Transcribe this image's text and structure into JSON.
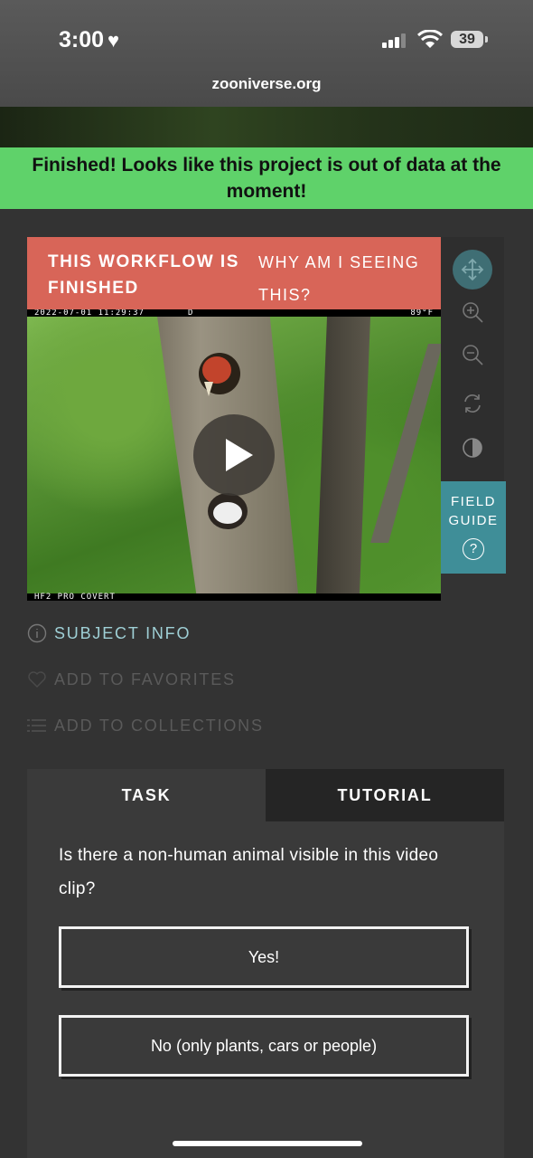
{
  "status_bar": {
    "time": "3:00",
    "battery": "39"
  },
  "browser": {
    "url": "zooniverse.org"
  },
  "banner": {
    "message": "Finished! Looks like this project is out of data at the moment!"
  },
  "workflow": {
    "finished_label": "THIS WORKFLOW IS FINISHED",
    "why_link": "WHY AM I SEEING THIS?"
  },
  "video": {
    "timestamp": "2022-07-01 11:29:37",
    "day_flag": "D",
    "temperature": "89°F",
    "camera_label": "HF2 PRO COVERT"
  },
  "toolbar": {
    "tools": [
      "move-icon",
      "zoom-in-icon",
      "zoom-out-icon",
      "rotate-icon",
      "contrast-icon"
    ],
    "field_guide_line1": "FIELD",
    "field_guide_line2": "GUIDE",
    "field_guide_icon": "?"
  },
  "meta": {
    "subject_info": "SUBJECT INFO",
    "add_favorites": "ADD TO FAVORITES",
    "add_collections": "ADD TO COLLECTIONS"
  },
  "tabs": {
    "task": "TASK",
    "tutorial": "TUTORIAL"
  },
  "task": {
    "question": "Is there a non-human animal visible in this video clip?",
    "answers": [
      "Yes!",
      "No (only plants, cars or people)"
    ]
  },
  "colors": {
    "banner": "#5fd26a",
    "finished_bar": "#d86558",
    "field_guide": "#3f8e98",
    "subject_info_text": "#9fd0d6",
    "muted_text": "#5a5a5a"
  }
}
